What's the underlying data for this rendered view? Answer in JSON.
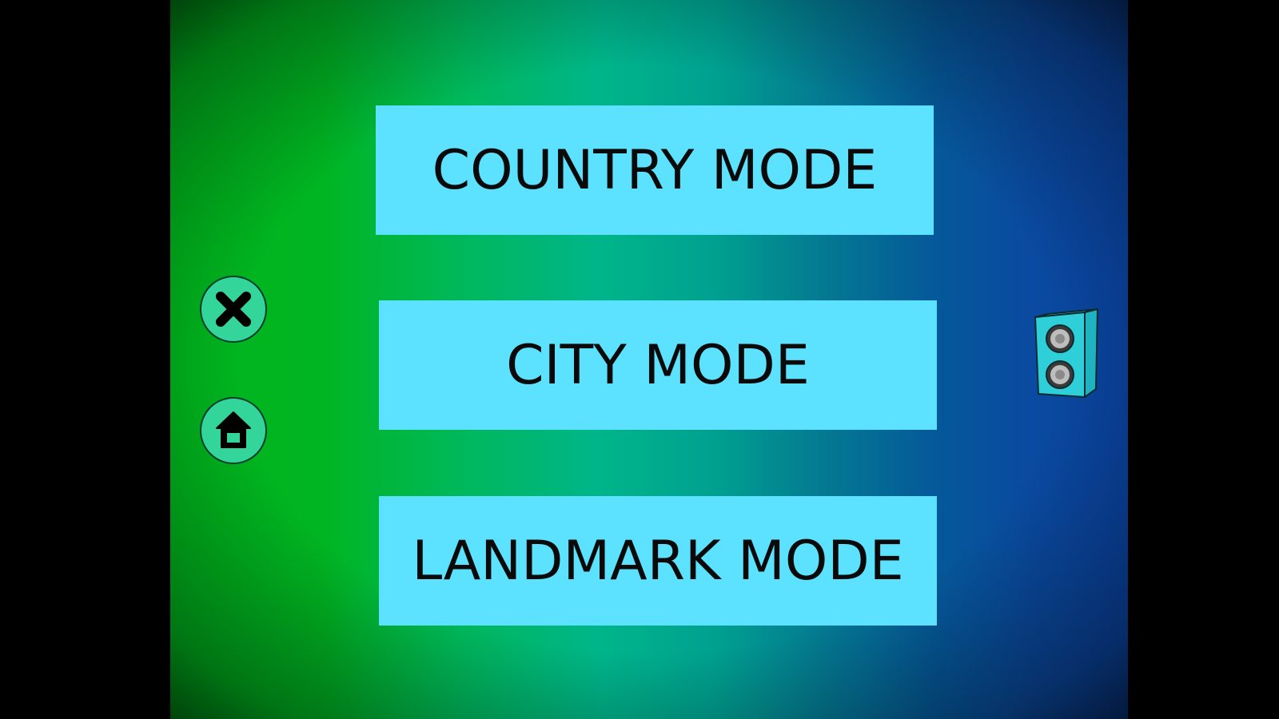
{
  "menu": {
    "buttons": [
      {
        "label": "COUNTRY MODE"
      },
      {
        "label": "CITY MODE"
      },
      {
        "label": "LANDMARK MODE"
      }
    ]
  },
  "side_controls": {
    "close_icon": "close-icon",
    "home_icon": "home-icon",
    "sound_icon": "speaker-icon"
  },
  "colors": {
    "button_fill": "#5ce1ff",
    "button_text": "#0a0a0a",
    "round_button_fill": "#33d59a",
    "speaker_fill": "#2ecfd8"
  }
}
